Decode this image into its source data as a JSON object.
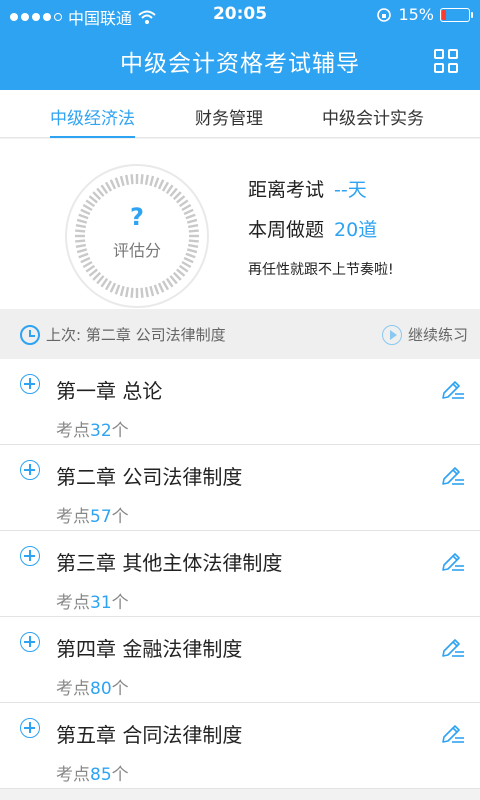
{
  "status": {
    "carrier": "中国联通",
    "time": "20:05",
    "battery": "15%"
  },
  "header": {
    "title": "中级会计资格考试辅导"
  },
  "tabs": [
    {
      "label": "中级经济法",
      "active": true
    },
    {
      "label": "财务管理",
      "active": false
    },
    {
      "label": "中级会计实务",
      "active": false
    }
  ],
  "stats": {
    "gauge_symbol": "?",
    "gauge_label": "评估分",
    "exam_label": "距离考试",
    "exam_value": "--天",
    "week_label": "本周做题",
    "week_value": "20道",
    "motto": "再任性就跟不上节奏啦!"
  },
  "last": {
    "text": "上次: 第二章 公司法律制度",
    "continue": "继续练习"
  },
  "chapters": [
    {
      "name": "第一章 总论",
      "prefix": "考点",
      "count": "32",
      "suffix": "个"
    },
    {
      "name": "第二章 公司法律制度",
      "prefix": "考点",
      "count": "57",
      "suffix": "个"
    },
    {
      "name": "第三章 其他主体法律制度",
      "prefix": "考点",
      "count": "31",
      "suffix": "个"
    },
    {
      "name": "第四章 金融法律制度",
      "prefix": "考点",
      "count": "80",
      "suffix": "个"
    },
    {
      "name": "第五章 合同法律制度",
      "prefix": "考点",
      "count": "85",
      "suffix": "个"
    }
  ],
  "colors": {
    "accent": "#2ea3f2"
  }
}
